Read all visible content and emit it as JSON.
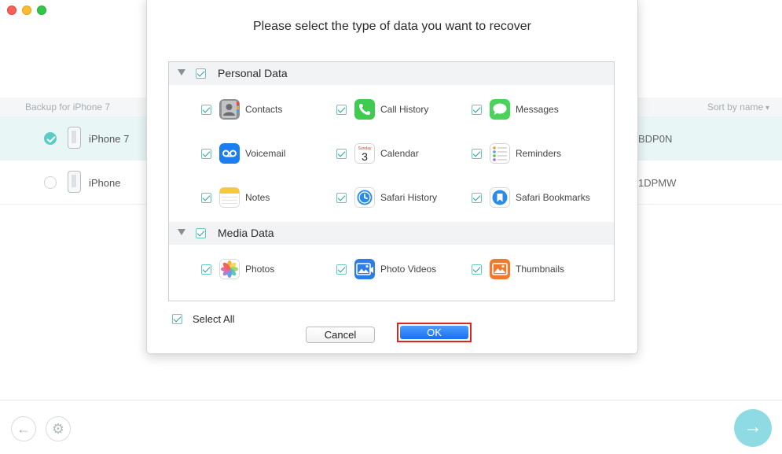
{
  "background": {
    "column_header": "Backup for iPhone 7",
    "sort_label": "Sort by name",
    "devices": [
      {
        "name": "iPhone 7",
        "serial": "BDP0N",
        "selected": true
      },
      {
        "name": "iPhone",
        "serial": "1DPMW",
        "selected": false
      }
    ]
  },
  "dialog": {
    "title": "Please select the type of data you want to recover",
    "sections": {
      "personal": {
        "label": "Personal Data",
        "items": [
          {
            "label": "Contacts",
            "icon": "contacts-icon"
          },
          {
            "label": "Call History",
            "icon": "phone-icon"
          },
          {
            "label": "Messages",
            "icon": "messages-icon"
          },
          {
            "label": "Voicemail",
            "icon": "voicemail-icon"
          },
          {
            "label": "Calendar",
            "icon": "calendar-icon",
            "icon_text": "3",
            "icon_small_text": "Sunday"
          },
          {
            "label": "Reminders",
            "icon": "reminders-icon"
          },
          {
            "label": "Notes",
            "icon": "notes-icon"
          },
          {
            "label": "Safari History",
            "icon": "safari-history-icon"
          },
          {
            "label": "Safari Bookmarks",
            "icon": "safari-bookmarks-icon"
          }
        ]
      },
      "media": {
        "label": "Media Data",
        "items": [
          {
            "label": "Photos",
            "icon": "photos-icon"
          },
          {
            "label": "Photo Videos",
            "icon": "photo-videos-icon"
          },
          {
            "label": "Thumbnails",
            "icon": "thumbnails-icon"
          }
        ]
      }
    },
    "select_all_label": "Select All",
    "cancel_label": "Cancel",
    "ok_label": "OK"
  },
  "colors": {
    "accent_teal": "#5bcbc6",
    "ok_blue": "#1a6ef3",
    "highlight_red": "#e2221d"
  }
}
